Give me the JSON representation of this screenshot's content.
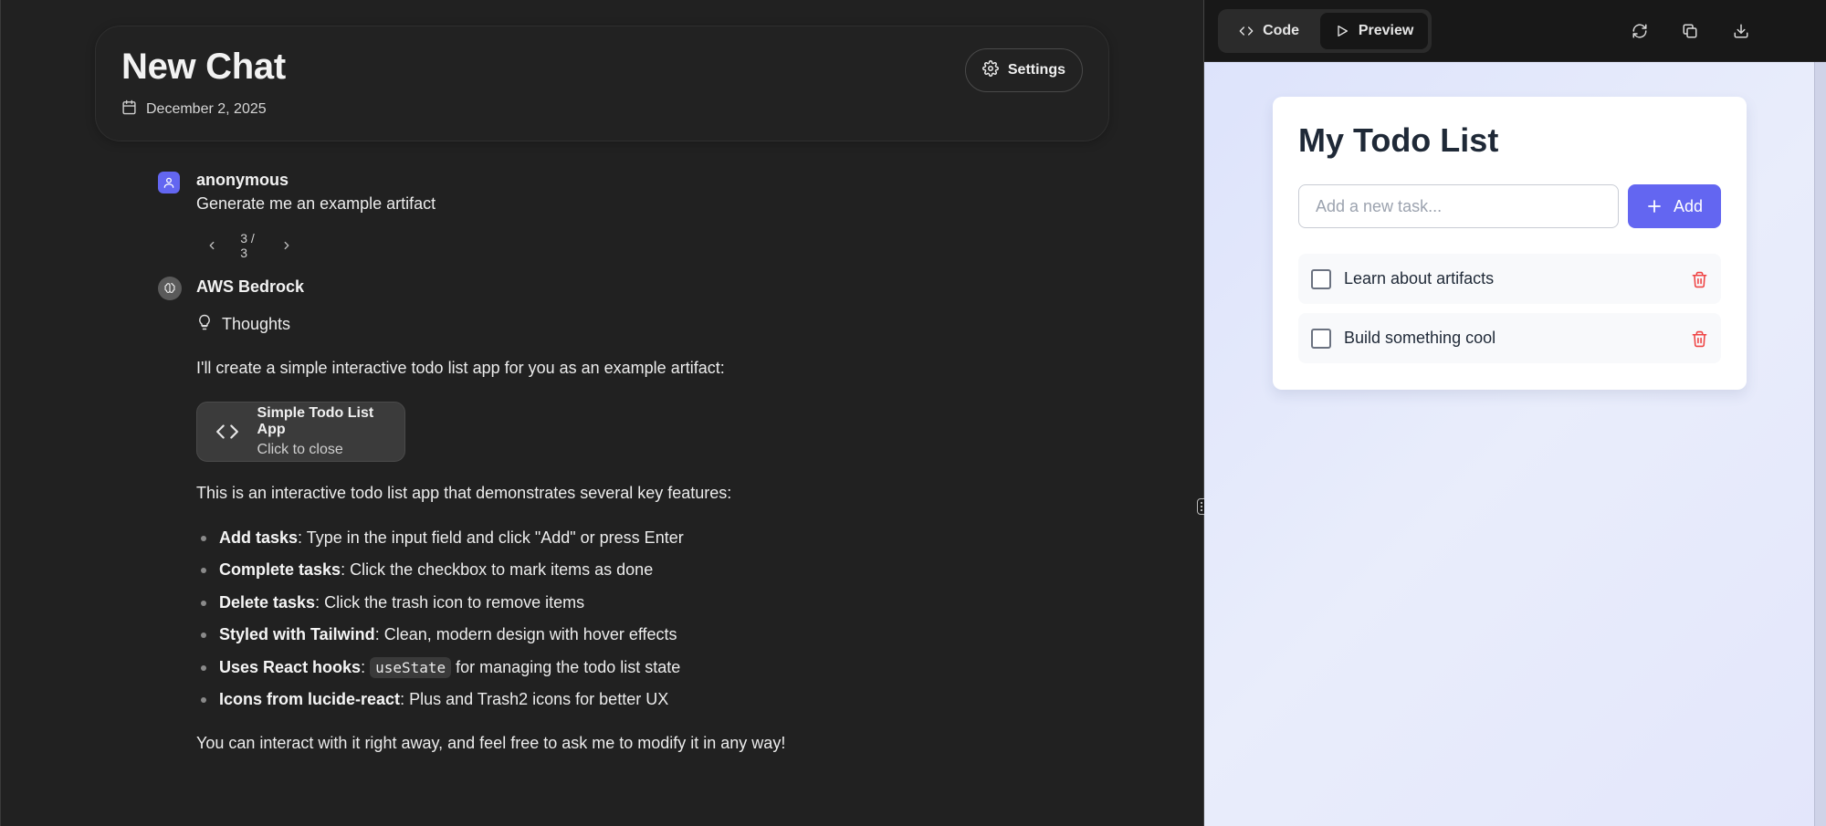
{
  "header": {
    "title": "New Chat",
    "date": "December 2, 2025",
    "settings_label": "Settings"
  },
  "user_message": {
    "sender": "anonymous",
    "text": "Generate me an example artifact",
    "pager": "3 / 3"
  },
  "assistant_message": {
    "sender": "AWS Bedrock",
    "thoughts_label": "Thoughts",
    "intro": "I'll create a simple interactive todo list app for you as an example artifact:",
    "artifact": {
      "title": "Simple Todo List App",
      "subtitle": "Click to close"
    },
    "features_intro": "This is an interactive todo list app that demonstrates several key features:",
    "features": [
      {
        "bold": "Add tasks",
        "text": ": Type in the input field and click \"Add\" or press Enter"
      },
      {
        "bold": "Complete tasks",
        "text": ": Click the checkbox to mark items as done"
      },
      {
        "bold": "Delete tasks",
        "text": ": Click the trash icon to remove items"
      },
      {
        "bold": "Styled with Tailwind",
        "text": ": Clean, modern design with hover effects"
      },
      {
        "bold": "Uses React hooks",
        "text_before": ": ",
        "code": "useState",
        "text": " for managing the todo list state"
      },
      {
        "bold": "Icons from lucide-react",
        "text": ": Plus and Trash2 icons for better UX"
      }
    ],
    "closing": "You can interact with it right away, and feel free to ask me to modify it in any way!"
  },
  "artifact_panel": {
    "tabs": {
      "code": "Code",
      "preview": "Preview"
    },
    "active_tab": "preview",
    "tools": [
      "refresh-icon",
      "copy-icon",
      "download-icon"
    ]
  },
  "todo_app": {
    "title": "My Todo List",
    "input_placeholder": "Add a new task...",
    "input_value": "",
    "add_label": "Add",
    "items": [
      {
        "label": "Learn about artifacts",
        "done": false
      },
      {
        "label": "Build something cool",
        "done": false
      }
    ]
  },
  "colors": {
    "accent": "#6366f1",
    "danger": "#ef4444",
    "chat_bg": "#212121",
    "preview_bg": "#e4e8fb"
  }
}
